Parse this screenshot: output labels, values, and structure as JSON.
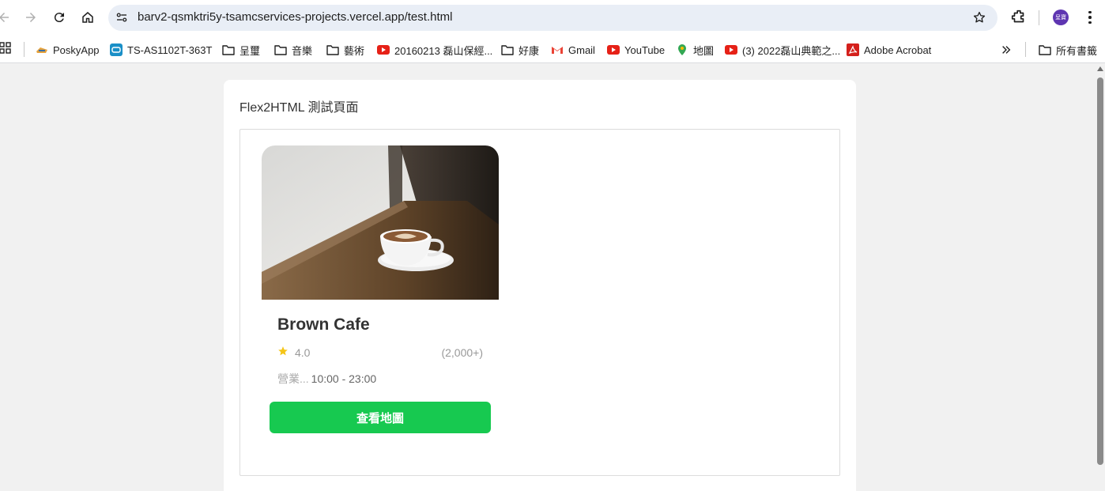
{
  "browser": {
    "url": "barv2-qsmktri5y-tsamcservices-projects.vercel.app/test.html",
    "avatar_text": "呈寶"
  },
  "bookmarks": {
    "items": [
      {
        "label": "PoskyApp",
        "icon": "posky-icon"
      },
      {
        "label": "TS-AS1102T-363T",
        "icon": "nas-icon"
      },
      {
        "label": "呈璽",
        "icon": "folder-icon"
      },
      {
        "label": "音樂",
        "icon": "folder-icon"
      },
      {
        "label": "藝術",
        "icon": "folder-icon"
      },
      {
        "label": "20160213 磊山保經...",
        "icon": "youtube-icon"
      },
      {
        "label": "好康",
        "icon": "folder-icon"
      },
      {
        "label": "Gmail",
        "icon": "gmail-icon"
      },
      {
        "label": "YouTube",
        "icon": "youtube-icon"
      },
      {
        "label": "地圖",
        "icon": "maps-icon"
      },
      {
        "label": "(3) 2022磊山典範之...",
        "icon": "youtube-icon"
      },
      {
        "label": "Adobe Acrobat",
        "icon": "acrobat-icon"
      }
    ],
    "all_bookmarks_label": "所有書籤"
  },
  "page": {
    "title": "Flex2HTML 測試頁面"
  },
  "card": {
    "name": "Brown Cafe",
    "rating": "4.0",
    "review_count": "(2,000+)",
    "hours_label": "營業...",
    "hours_value": "10:00 - 23:00",
    "button_label": "查看地圖",
    "colors": {
      "button": "#17c950",
      "star": "#f5c518"
    }
  }
}
